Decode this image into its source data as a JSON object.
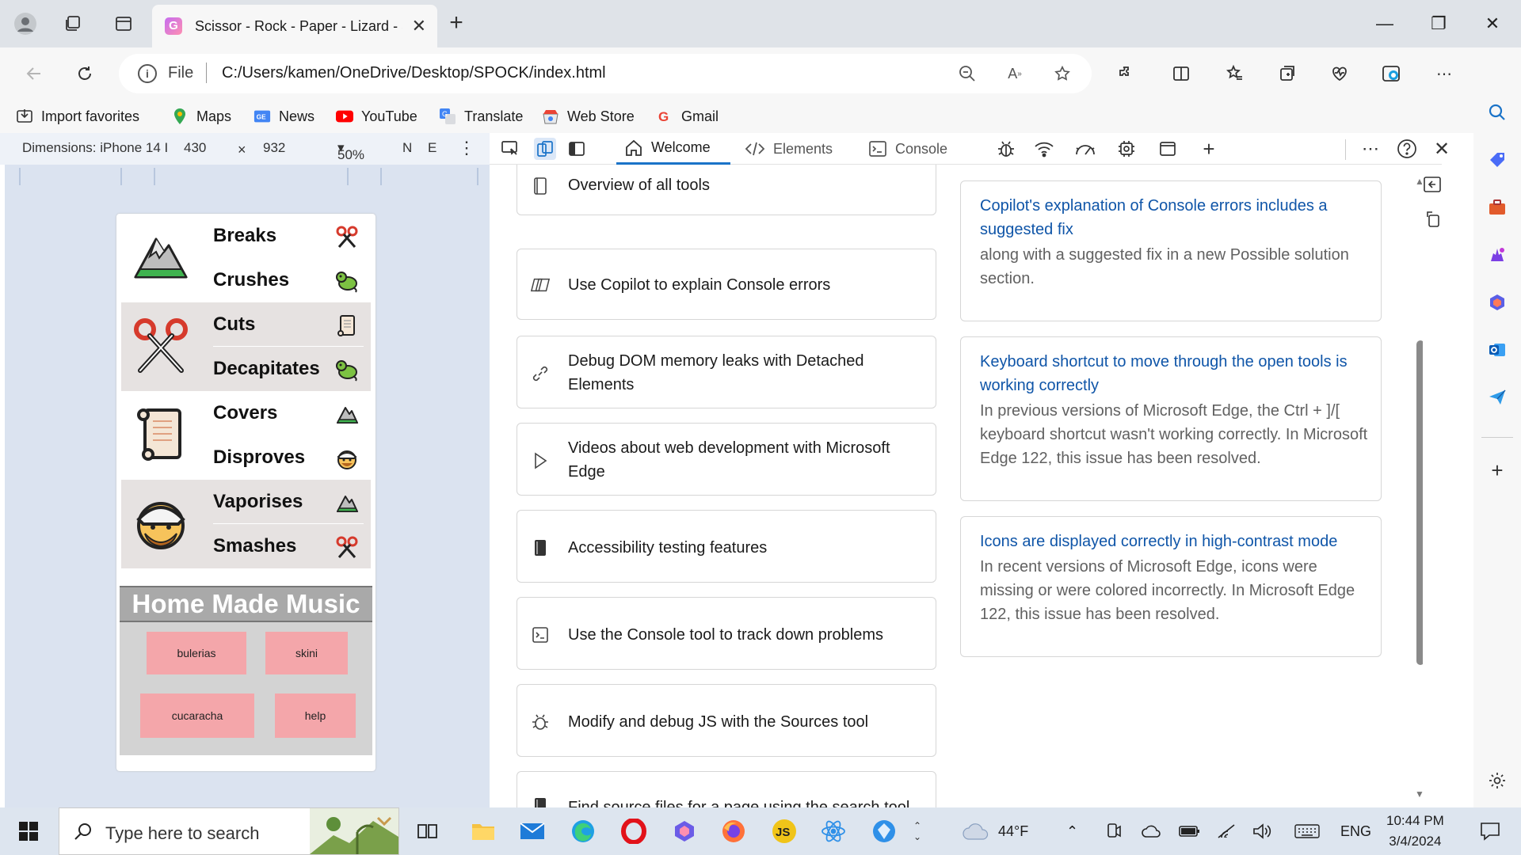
{
  "browser": {
    "tab_title": "Scissor - Rock - Paper - Lizard - S",
    "tab_favicon": "G",
    "address": {
      "scheme_label": "File",
      "url": "C:/Users/kamen/OneDrive/Desktop/SPOCK/index.html"
    },
    "favorites": [
      {
        "label": "Import favorites",
        "icon": "import-icon"
      },
      {
        "label": "Maps",
        "icon": "maps-icon"
      },
      {
        "label": "News",
        "icon": "news-icon"
      },
      {
        "label": "YouTube",
        "icon": "youtube-icon"
      },
      {
        "label": "Translate",
        "icon": "translate-icon"
      },
      {
        "label": "Web Store",
        "icon": "web-store-icon"
      },
      {
        "label": "Gmail",
        "icon": "gmail-icon"
      }
    ]
  },
  "device_toolbar": {
    "dimensions_label": "Dimensions: iPhone 14 I",
    "width": "430",
    "times": "×",
    "height": "932",
    "zoom": "50%",
    "more_label": "N",
    "extra_label": "E"
  },
  "app_page": {
    "groups": [
      {
        "icon": "mountain-icon",
        "rows": [
          {
            "verb": "Breaks",
            "target_icon": "scissors-icon"
          },
          {
            "verb": "Crushes",
            "target_icon": "lizard-icon"
          }
        ]
      },
      {
        "icon": "scissors-icon",
        "rows": [
          {
            "verb": "Cuts",
            "target_icon": "paper-icon"
          },
          {
            "verb": "Decapitates",
            "target_icon": "lizard-icon"
          }
        ]
      },
      {
        "icon": "paper-icon",
        "rows": [
          {
            "verb": "Covers",
            "target_icon": "rock-icon"
          },
          {
            "verb": "Disproves",
            "target_icon": "spock-icon"
          }
        ]
      },
      {
        "icon": "spock-icon",
        "rows": [
          {
            "verb": "Vaporises",
            "target_icon": "rock-icon"
          },
          {
            "verb": "Smashes",
            "target_icon": "scissors-icon"
          }
        ]
      }
    ],
    "music": {
      "heading": "Home Made Music",
      "buttons": [
        "bulerias",
        "skini",
        "cucaracha",
        "help"
      ]
    }
  },
  "devtools": {
    "tabs": [
      {
        "label": "Welcome",
        "icon": "home-icon",
        "active": true
      },
      {
        "label": "Elements",
        "icon": "code-icon",
        "active": false
      },
      {
        "label": "Console",
        "icon": "console-icon",
        "active": false
      }
    ],
    "cards": [
      {
        "label": "Overview of all tools",
        "icon": "book-icon"
      },
      {
        "label": "Use Copilot to explain Console errors",
        "icon": "copilot-icon"
      },
      {
        "label": "Debug DOM memory leaks with Detached Elements",
        "icon": "link-icon"
      },
      {
        "label": "Videos about web development with Microsoft Edge",
        "icon": "play-icon"
      },
      {
        "label": "Accessibility testing features",
        "icon": "book-filled-icon"
      },
      {
        "label": "Use the Console tool to track down problems",
        "icon": "console-icon"
      },
      {
        "label": "Modify and debug JS with the Sources tool",
        "icon": "bug-icon"
      },
      {
        "label": "Find source files for a page using the search tool",
        "icon": "book-filled-icon"
      }
    ],
    "news": [
      {
        "title": "Copilot's explanation of Console errors includes a suggested fix",
        "desc": "along with a suggested fix in a new Possible solution section."
      },
      {
        "title": "Keyboard shortcut to move through the open tools is working correctly",
        "desc": "In previous versions of Microsoft Edge, the Ctrl + ]/[ keyboard shortcut wasn't working correctly. In Microsoft Edge 122, this issue has been resolved."
      },
      {
        "title": "Icons are displayed correctly in high-contrast mode",
        "desc": "In recent versions of Microsoft Edge, icons were missing or were colored incorrectly. In Microsoft Edge 122, this issue has been resolved."
      }
    ]
  },
  "taskbar": {
    "search_placeholder": "Type here to search",
    "weather": "44°F",
    "language": "ENG",
    "time": "10:44 PM",
    "date": "3/4/2024"
  },
  "colors": {
    "accent": "#1a73c8",
    "link": "#0f55a8",
    "music_button": "#f4a6aa"
  }
}
